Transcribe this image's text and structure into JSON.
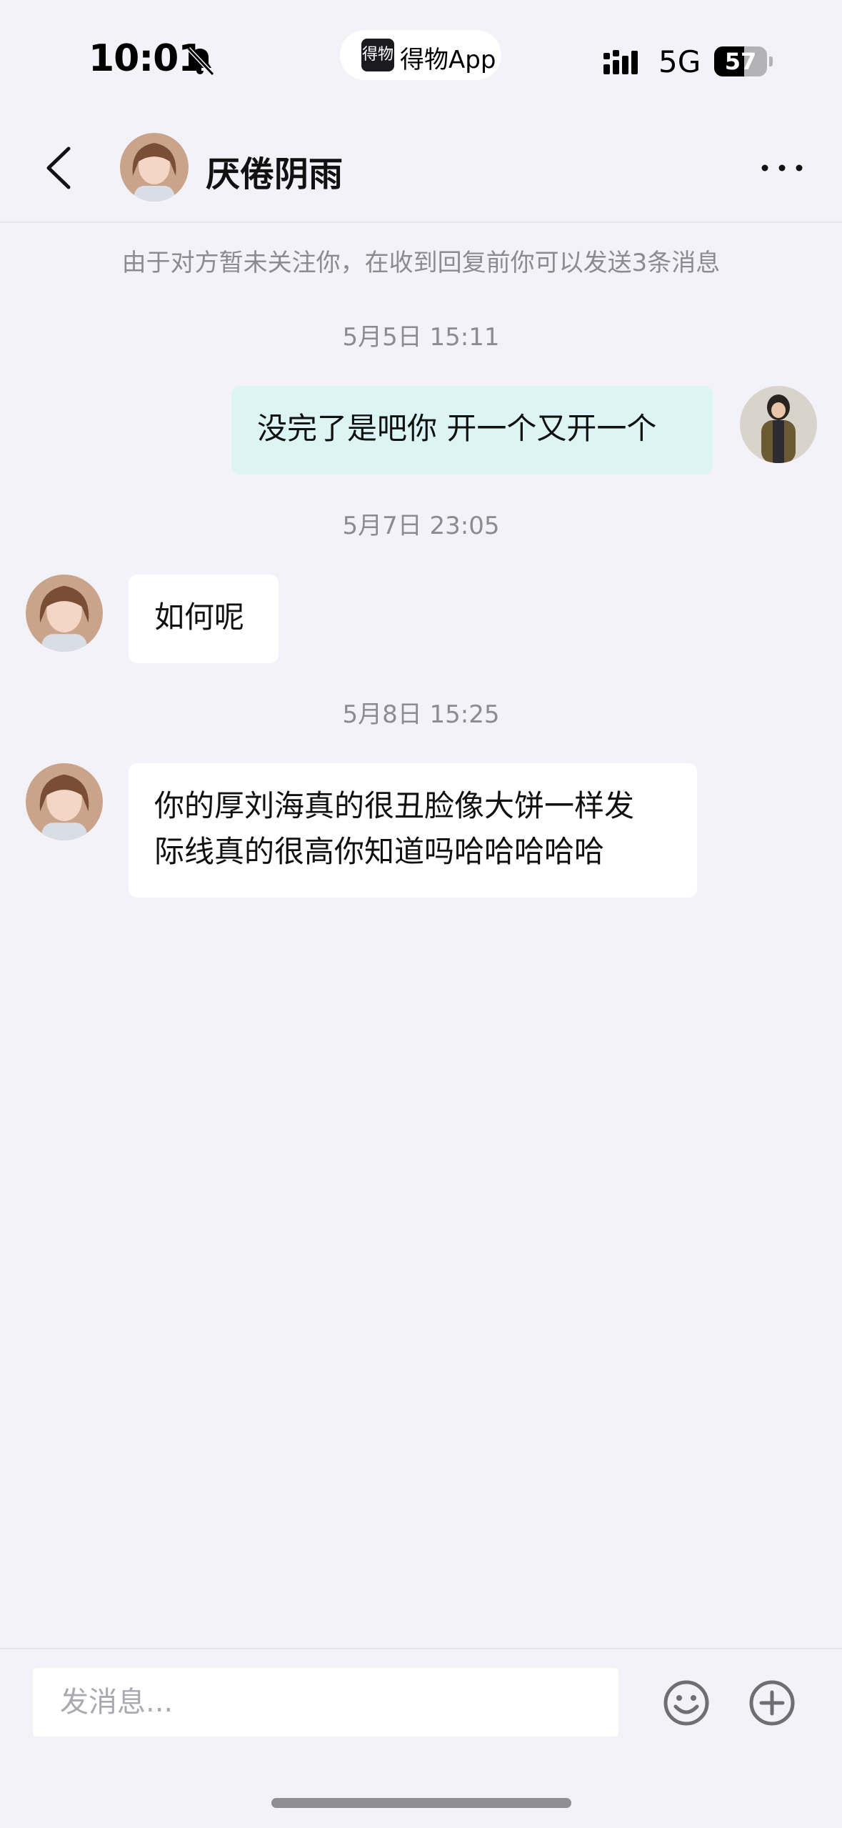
{
  "status_bar": {
    "time": "10:01",
    "app_pill": "得物App",
    "app_logo": "得物",
    "network": "5G",
    "battery": "57",
    "battery_level": 0.57,
    "icons": [
      "bell-muted-icon",
      "signal-icon",
      "battery-icon"
    ]
  },
  "header": {
    "title": "厌倦阴雨",
    "back_icon": "chevron-left-icon",
    "more_icon": "ellipsis-icon"
  },
  "notice": "由于对方暂未关注你，在收到回复前你可以发送3条消息",
  "messages": [
    {
      "timestamp": "5月5日 15:11",
      "sender": "me",
      "text": "没完了是吧你 开一个又开一个"
    },
    {
      "timestamp": "5月7日 23:05",
      "sender": "them",
      "text": "如何呢"
    },
    {
      "timestamp": "5月8日 15:25",
      "sender": "them",
      "text_line1": "你的厚刘海真的很丑脸像大饼一样发",
      "text_line2": "际线真的很高你知道吗哈哈哈哈哈"
    }
  ],
  "input": {
    "placeholder": "发消息...",
    "value": "",
    "emoji_icon": "smiley-icon",
    "plus_icon": "plus-circle-icon"
  },
  "colors": {
    "background": "#f3f2f8",
    "my_bubble": "#dcf4f4",
    "their_bubble": "#ffffff",
    "muted_text": "#8b8b93"
  }
}
